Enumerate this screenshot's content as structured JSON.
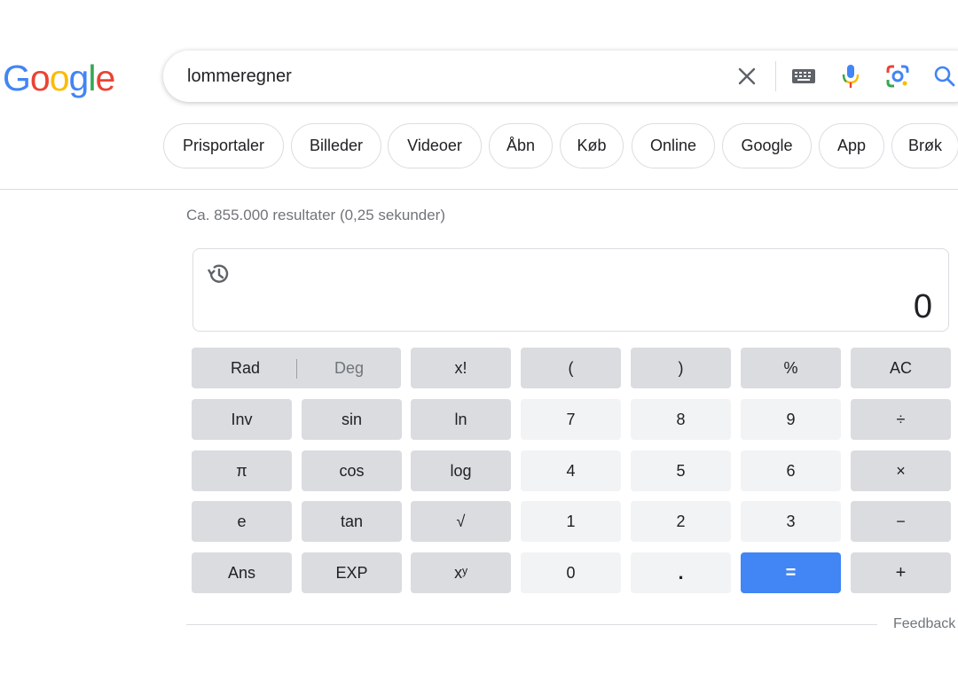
{
  "logo": {
    "letters": [
      {
        "ch": "G",
        "color": "#4285f4"
      },
      {
        "ch": "o",
        "color": "#ea4335"
      },
      {
        "ch": "o",
        "color": "#fbbc05"
      },
      {
        "ch": "g",
        "color": "#4285f4"
      },
      {
        "ch": "l",
        "color": "#34a853"
      },
      {
        "ch": "e",
        "color": "#ea4335"
      }
    ]
  },
  "search": {
    "query": "lommeregner",
    "icons": [
      "clear-icon",
      "keyboard-icon",
      "microphone-icon",
      "lens-icon",
      "search-icon"
    ]
  },
  "chips": [
    "Prisportaler",
    "Billeder",
    "Videoer",
    "Åbn",
    "Køb",
    "Online",
    "Google",
    "App",
    "Brøk"
  ],
  "stats": "Ca. 855.000 resultater (0,25 sekunder)",
  "calculator": {
    "display": "0",
    "rad_label": "Rad",
    "deg_label": "Deg",
    "keys": {
      "fact": "x!",
      "lparen": "(",
      "rparen": ")",
      "percent": "%",
      "ac": "AC",
      "inv": "Inv",
      "sin": "sin",
      "ln": "ln",
      "seven": "7",
      "eight": "8",
      "nine": "9",
      "divide": "÷",
      "pi": "π",
      "cos": "cos",
      "log": "log",
      "four": "4",
      "five": "5",
      "six": "6",
      "multiply": "×",
      "e": "e",
      "tan": "tan",
      "sqrt": "√",
      "one": "1",
      "two": "2",
      "three": "3",
      "minus": "−",
      "ans": "Ans",
      "exp": "EXP",
      "pow": "xʸ",
      "zero": "0",
      "dot": ".",
      "equals": "=",
      "plus": "+"
    },
    "colors": {
      "dark": "#dadce0",
      "light": "#f1f3f4",
      "equals": "#4285f4"
    }
  },
  "feedback": "Feedback"
}
